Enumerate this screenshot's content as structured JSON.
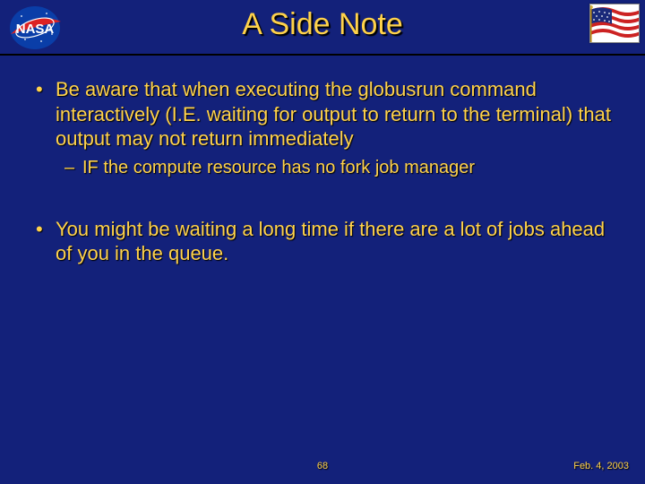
{
  "title": "A Side Note",
  "bullets": {
    "b1": "Be aware that when executing the globusrun command interactively (I.E. waiting for output to return to the terminal) that output may not return immediately",
    "b1_sub1": "IF the compute resource has no fork job manager",
    "b2": "You might be waiting a long time if there are a lot of jobs ahead of you in the queue."
  },
  "footer": {
    "page": "68",
    "date": "Feb. 4, 2003"
  },
  "logos": {
    "nasa": "nasa-logo",
    "flag": "us-flag"
  }
}
